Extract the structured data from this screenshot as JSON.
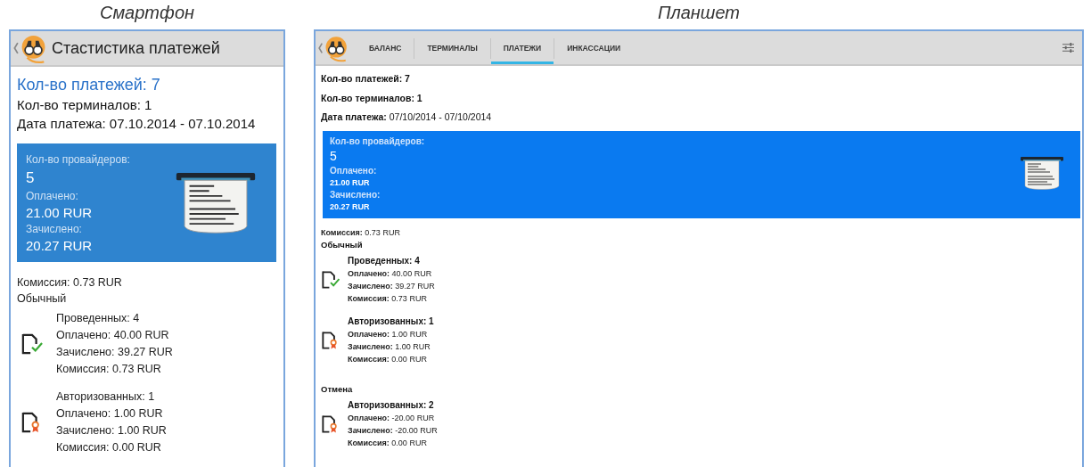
{
  "phone": {
    "caption": "Смартфон",
    "header": {
      "title": "Стастистика платежей"
    },
    "summary": {
      "payments": "Кол-во платежей: 7",
      "terminals": "Кол-во терминалов: 1",
      "date": "Дата платежа: 07.10.2014 - 07.10.2014"
    },
    "card": {
      "providers_label": "Кол-во провайдеров:",
      "providers": "5",
      "paid_label": "Оплачено:",
      "paid": "21.00 RUR",
      "credited_label": "Зачислено:",
      "credited": "20.27 RUR"
    },
    "commission": "Комиссия: 0.73 RUR",
    "sections": [
      {
        "title": "Обычный",
        "groups": [
          {
            "kind": "completed",
            "lines": [
              "Проведенных: 4",
              "Оплачено: 40.00 RUR",
              "Зачислено: 39.27 RUR",
              "Комиссия: 0.73 RUR"
            ]
          },
          {
            "kind": "authorized",
            "lines": [
              "Авторизованных: 1",
              "Оплачено: 1.00 RUR",
              "Зачислено: 1.00 RUR",
              "Комиссия: 0.00 RUR"
            ]
          }
        ]
      }
    ]
  },
  "tablet": {
    "caption": "Планшет",
    "tabs": [
      {
        "label": "БАЛАНС",
        "selected": false
      },
      {
        "label": "ТЕРМИНАЛЫ",
        "selected": false
      },
      {
        "label": "ПЛАТЕЖИ",
        "selected": true
      },
      {
        "label": "ИНКАССАЦИИ",
        "selected": false
      }
    ],
    "summary": {
      "payments": "Кол-во платежей: 7",
      "terminals": "Кол-во терминалов: 1",
      "date": "**Дата платежа:** 07/10/2014 - 07/10/2014"
    },
    "card": {
      "providers_label": "Кол-во провайдеров:",
      "providers": "5",
      "paid_label": "Оплачено:",
      "paid": "21.00 RUR",
      "credited_label": "Зачислено:",
      "credited": "20.27 RUR"
    },
    "commission": "**Комиссия:** 0.73 RUR",
    "sections": [
      {
        "title": "Обычный",
        "groups": [
          {
            "kind": "completed",
            "lines": [
              "Проведенных: 4",
              "**Оплачено:** 40.00 RUR",
              "**Зачислено:** 39.27 RUR",
              "**Комиссия:** 0.73 RUR"
            ]
          },
          {
            "kind": "authorized",
            "lines": [
              "Авторизованных: 1",
              "**Оплачено:** 1.00 RUR",
              "**Зачислено:** 1.00 RUR",
              "**Комиссия:** 0.00 RUR"
            ]
          }
        ]
      },
      {
        "title": "Отмена",
        "groups": [
          {
            "kind": "authorized",
            "lines": [
              "Авторизованных: 2",
              "**Оплачено:** -20.00 RUR",
              "**Зачислено:** -20.00 RUR",
              "**Комиссия:** 0.00 RUR"
            ]
          }
        ]
      }
    ]
  }
}
